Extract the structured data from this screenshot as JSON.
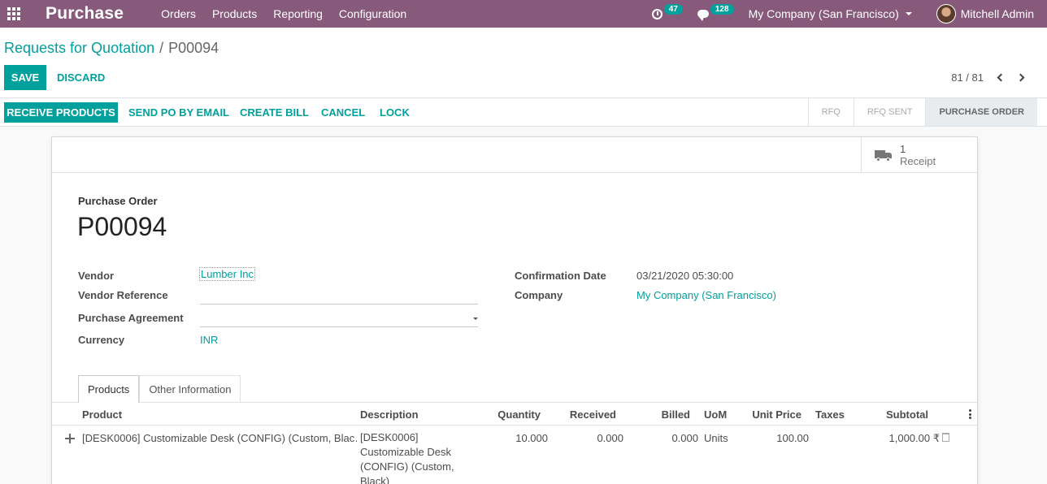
{
  "navbar": {
    "brand": "Purchase",
    "menu": [
      "Orders",
      "Products",
      "Reporting",
      "Configuration"
    ],
    "activity_count": "47",
    "message_count": "128",
    "company": "My Company (San Francisco)",
    "user": "Mitchell Admin"
  },
  "breadcrumb": {
    "parent": "Requests for Quotation",
    "separator": "/",
    "current": "P00094"
  },
  "actions": {
    "save": "SAVE",
    "discard": "DISCARD"
  },
  "pager": {
    "value": "81 / 81"
  },
  "workflow_buttons": {
    "receive": "RECEIVE PRODUCTS",
    "send_email": "SEND PO BY EMAIL",
    "create_bill": "CREATE BILL",
    "cancel": "CANCEL",
    "lock": "LOCK"
  },
  "status_steps": [
    {
      "label": "RFQ",
      "active": false
    },
    {
      "label": "RFQ SENT",
      "active": false
    },
    {
      "label": "PURCHASE ORDER",
      "active": true
    }
  ],
  "smart_button": {
    "value": "1",
    "label": "Receipt"
  },
  "form": {
    "title_label": "Purchase Order",
    "name": "P00094",
    "left_fields": {
      "vendor_label": "Vendor",
      "vendor_value": "Lumber Inc",
      "vendor_ref_label": "Vendor Reference",
      "vendor_ref_value": "",
      "agreement_label": "Purchase Agreement",
      "agreement_value": "",
      "currency_label": "Currency",
      "currency_value": "INR"
    },
    "right_fields": {
      "confirmation_label": "Confirmation Date",
      "confirmation_value": "03/21/2020 05:30:00",
      "company_label": "Company",
      "company_value": "My Company (San Francisco)"
    }
  },
  "tabs": [
    "Products",
    "Other Information"
  ],
  "table": {
    "columns": [
      "Product",
      "Description",
      "Quantity",
      "Received",
      "Billed",
      "UoM",
      "Unit Price",
      "Taxes",
      "Subtotal"
    ],
    "rows": [
      {
        "product": "[DESK0006] Customizable Desk (CONFIG) (Custom, Blac…",
        "description_lines": [
          "[DESK0006]",
          "Customizable Desk",
          "(CONFIG) (Custom,",
          "Black)"
        ],
        "quantity": "10.000",
        "received": "0.000",
        "billed": "0.000",
        "uom": "Units",
        "unit_price": "100.00",
        "taxes": "",
        "subtotal": "1,000.00 ₹"
      }
    ]
  }
}
